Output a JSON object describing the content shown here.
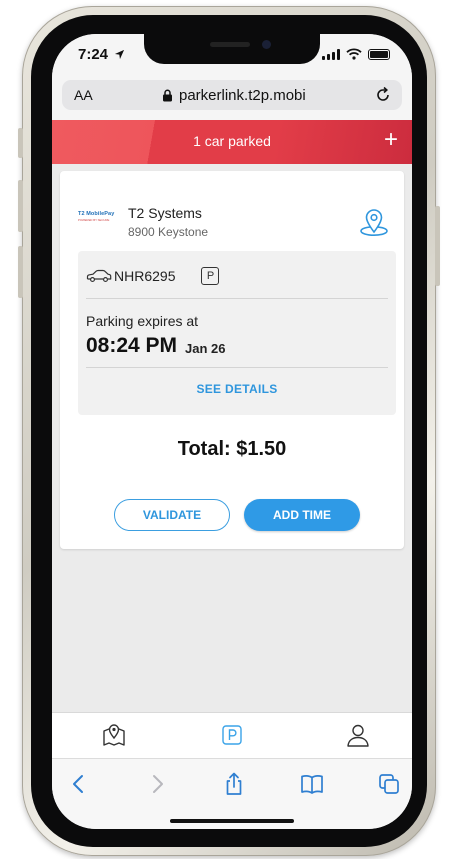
{
  "status": {
    "time": "7:24",
    "location_arrow": "location-arrow-icon"
  },
  "browser": {
    "aa_label": "AA",
    "url": "parkerlink.t2p.mobi"
  },
  "banner": {
    "text": "1 car parked",
    "add_label": "+"
  },
  "colors": {
    "banner_red": "#e23d48",
    "accent_blue": "#2f96dd",
    "add_time_blue": "#2f9ae6",
    "card_bg": "#ffffff",
    "inner_bg": "#f1f1f1"
  },
  "location": {
    "logo_text": "T2 MobilePay",
    "logo_subtext": "POWERED BY SECURE",
    "company": "T2 Systems",
    "address": "8900 Keystone"
  },
  "parking": {
    "plate": "NHR6295",
    "permit_badge": "P",
    "expires_label": "Parking expires at",
    "expires_time": "08:24 PM",
    "expires_date": "Jan 26",
    "see_details": "SEE DETAILS"
  },
  "total": {
    "label": "Total: $1.50"
  },
  "actions": {
    "validate": "VALIDATE",
    "add_time": "ADD TIME"
  },
  "app_nav": {
    "items": [
      {
        "icon": "map-pin-icon",
        "active": false
      },
      {
        "icon": "parking-icon",
        "active": true
      },
      {
        "icon": "user-icon",
        "active": false
      }
    ]
  },
  "safari_toolbar": {
    "items": [
      "back-icon",
      "forward-icon",
      "share-icon",
      "bookmarks-icon",
      "tabs-icon"
    ]
  }
}
